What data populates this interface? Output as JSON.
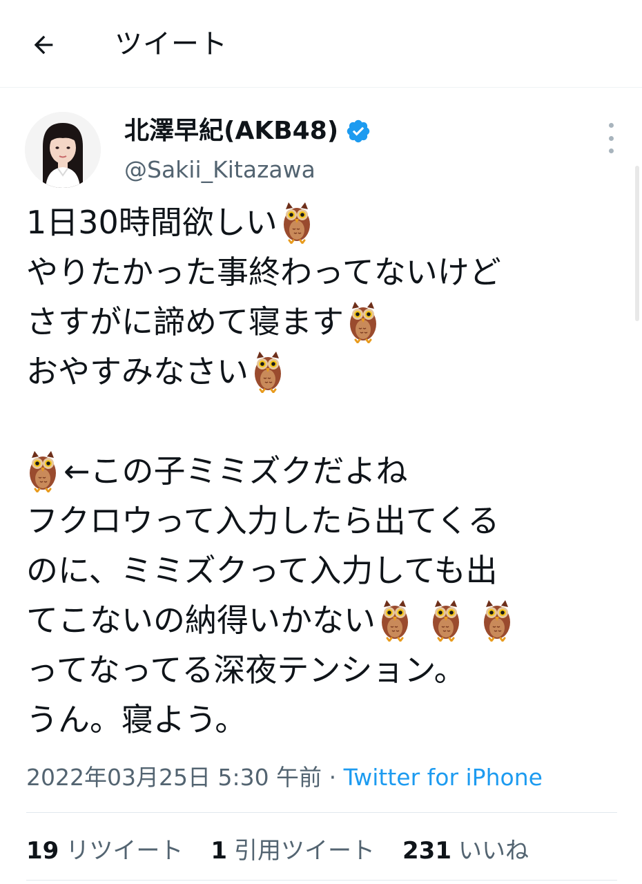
{
  "header": {
    "title": "ツイート"
  },
  "author": {
    "name": "北澤早紀(AKB48)",
    "handle": "@Sakii_Kitazawa"
  },
  "tweet": {
    "lines": [
      "1日30時間欲しい",
      "やりたかった事終わってないけど",
      "さすがに諦めて寝ます",
      "おやすみなさい",
      "",
      "←この子ミミズクだよね",
      "フクロウって入力したら出てくる",
      "のに、ミミズクって入力しても出",
      "てこないの納得いかない",
      "ってなってる深夜テンション。",
      "うん。寝よう。"
    ]
  },
  "meta": {
    "timestamp": "2022年03月25日 5:30 午前",
    "separator": "·",
    "source": "Twitter for iPhone"
  },
  "stats": {
    "retweets": {
      "count": "19",
      "label": "リツイート"
    },
    "quotes": {
      "count": "1",
      "label": "引用ツイート"
    },
    "likes": {
      "count": "231",
      "label": "いいね"
    }
  },
  "colors": {
    "text": "#0f1419",
    "secondary": "#536471",
    "accent": "#1d9bf0",
    "verified": "#1d9bf0",
    "owl_body": "#9a4b2e"
  },
  "icons": {
    "back": "arrow-left-icon",
    "verified": "verified-badge-icon",
    "more": "more-vertical-icon",
    "emoji": "owl-emoji"
  }
}
